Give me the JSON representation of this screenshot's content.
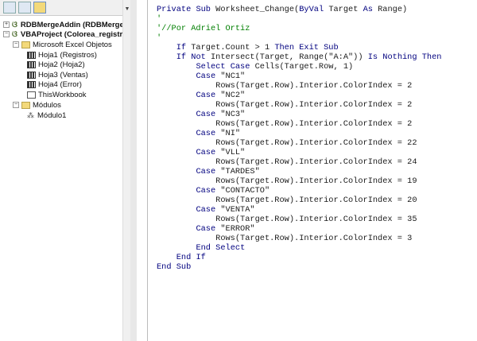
{
  "project_explorer": {
    "toolbar": [
      "view-code-icon",
      "view-object-icon",
      "toggle-folders-icon"
    ],
    "nodes": [
      {
        "label": "RDBMergeAddin (RDBMerge.x",
        "type": "project",
        "expanded": false
      },
      {
        "label": "VBAProject (Colorea_registros",
        "type": "project",
        "expanded": true
      },
      {
        "label": "Microsoft Excel Objetos",
        "type": "folder",
        "expanded": true
      },
      {
        "label": "Hoja1 (Registros)",
        "type": "sheet"
      },
      {
        "label": "Hoja2 (Hoja2)",
        "type": "sheet"
      },
      {
        "label": "Hoja3 (Ventas)",
        "type": "sheet"
      },
      {
        "label": "Hoja4 (Error)",
        "type": "sheet"
      },
      {
        "label": "ThisWorkbook",
        "type": "workbook"
      },
      {
        "label": "Módulos",
        "type": "folder",
        "expanded": true
      },
      {
        "label": "Módulo1",
        "type": "module"
      }
    ]
  },
  "code": {
    "lines": [
      "Private Sub Worksheet_Change(ByVal Target As Range)",
      "'",
      "'//Por Adriel Ortiz",
      "'",
      "    If Target.Count > 1 Then Exit Sub",
      "    If Not Intersect(Target, Range(\"A:A\")) Is Nothing Then",
      "        Select Case Cells(Target.Row, 1)",
      "        Case \"NC1\"",
      "            Rows(Target.Row).Interior.ColorIndex = 2",
      "        Case \"NC2\"",
      "            Rows(Target.Row).Interior.ColorIndex = 2",
      "        Case \"NC3\"",
      "            Rows(Target.Row).Interior.ColorIndex = 2",
      "        Case \"NI\"",
      "            Rows(Target.Row).Interior.ColorIndex = 22",
      "        Case \"VLL\"",
      "            Rows(Target.Row).Interior.ColorIndex = 24",
      "        Case \"TARDES\"",
      "            Rows(Target.Row).Interior.ColorIndex = 19",
      "        Case \"CONTACTO\"",
      "            Rows(Target.Row).Interior.ColorIndex = 20",
      "        Case \"VENTA\"",
      "            Rows(Target.Row).Interior.ColorIndex = 35",
      "        Case \"ERROR\"",
      "            Rows(Target.Row).Interior.ColorIndex = 3",
      "        End Select",
      "    End If",
      "End Sub"
    ]
  }
}
